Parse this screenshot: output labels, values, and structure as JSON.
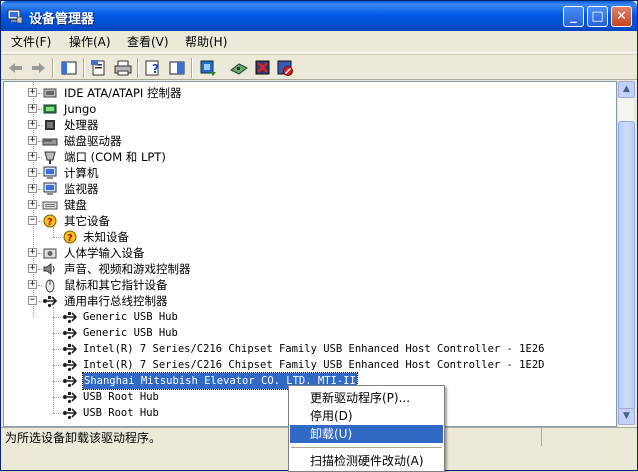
{
  "window": {
    "title": "设备管理器",
    "controls": {
      "minimize": "_",
      "maximize": "□",
      "close": "✕"
    }
  },
  "menu": {
    "file": "文件(F)",
    "action": "操作(A)",
    "view": "查看(V)",
    "help": "帮助(H)"
  },
  "toolbar": {
    "icons": [
      "back-icon",
      "forward-icon",
      "show-hide-tree-icon",
      "properties-icon",
      "print-icon",
      "help-icon",
      "console-tree-icon",
      "update-driver-icon",
      "scan-hardware-icon",
      "uninstall-icon",
      "disable-icon"
    ]
  },
  "tree": {
    "items": [
      {
        "label": "IDE ATA/ATAPI 控制器",
        "icon": "ide-controller-icon",
        "expander": "+"
      },
      {
        "label": "Jungo",
        "icon": "jungo-device-icon",
        "expander": "+"
      },
      {
        "label": "处理器",
        "icon": "processor-icon",
        "expander": "+"
      },
      {
        "label": "磁盘驱动器",
        "icon": "disk-drive-icon",
        "expander": "+"
      },
      {
        "label": "端口 (COM 和 LPT)",
        "icon": "port-icon",
        "expander": "+"
      },
      {
        "label": "计算机",
        "icon": "computer-icon",
        "expander": "+"
      },
      {
        "label": "监视器",
        "icon": "monitor-icon",
        "expander": "+"
      },
      {
        "label": "键盘",
        "icon": "keyboard-icon",
        "expander": "+"
      },
      {
        "label": "其它设备",
        "icon": "other-devices-icon",
        "expander": "−"
      },
      {
        "label": "未知设备",
        "icon": "unknown-device-icon",
        "child": true
      },
      {
        "label": "人体学输入设备",
        "icon": "hid-icon",
        "expander": "+"
      },
      {
        "label": "声音、视频和游戏控制器",
        "icon": "sound-icon",
        "expander": "+"
      },
      {
        "label": "鼠标和其它指针设备",
        "icon": "mouse-icon",
        "expander": "+"
      },
      {
        "label": "通用串行总线控制器",
        "icon": "usb-controller-icon",
        "expander": "−"
      },
      {
        "label": "Generic USB Hub",
        "icon": "usb-icon",
        "child": true
      },
      {
        "label": "Generic USB Hub",
        "icon": "usb-icon",
        "child": true
      },
      {
        "label": "Intel(R) 7 Series/C216 Chipset Family USB Enhanced Host Controller - 1E26",
        "icon": "usb-icon",
        "child": true
      },
      {
        "label": "Intel(R) 7 Series/C216 Chipset Family USB Enhanced Host Controller - 1E2D",
        "icon": "usb-icon",
        "child": true
      },
      {
        "label": "Shanghai Mitsubish Elevator CO. LTD. MTI-II",
        "icon": "usb-icon",
        "child": true,
        "selected": true
      },
      {
        "label": "USB Root Hub",
        "icon": "usb-icon",
        "child": true
      },
      {
        "label": "USB Root Hub",
        "icon": "usb-icon",
        "child": true
      }
    ]
  },
  "context_menu": {
    "update_driver": "更新驱动程序(P)...",
    "disable": "停用(D)",
    "uninstall": "卸载(U)",
    "scan": "扫描检测硬件改动(A)"
  },
  "status": {
    "text": "为所选设备卸载该驱动程序。"
  },
  "colors": {
    "titlebar": "#0058e6",
    "selection": "#316ac5",
    "window_bg": "#ece9d8"
  }
}
